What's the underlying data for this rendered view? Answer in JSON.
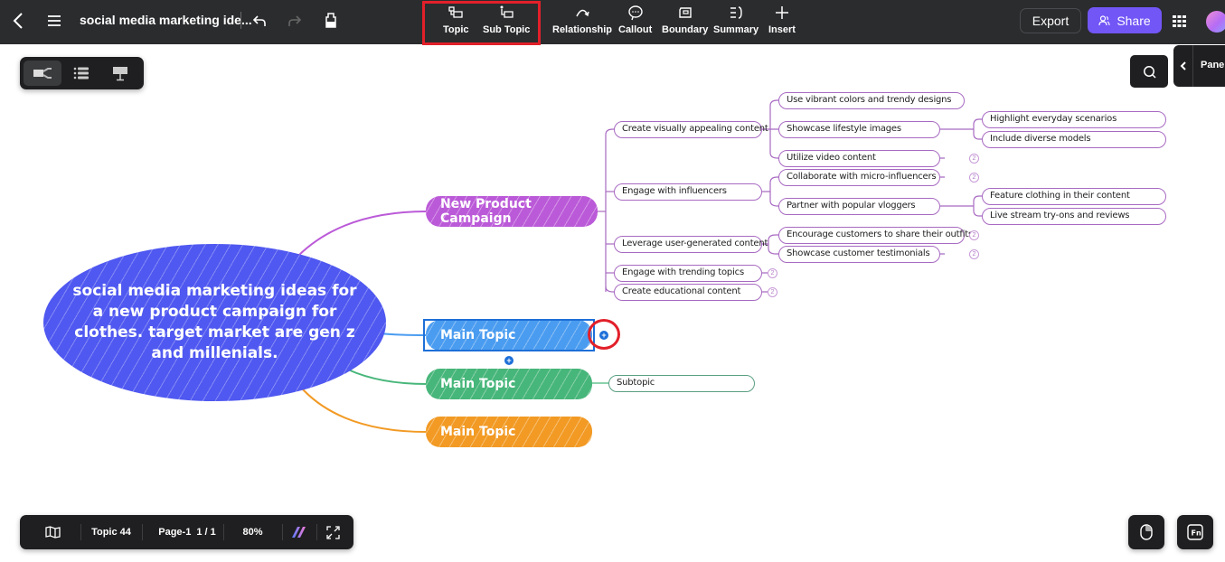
{
  "header": {
    "title": "social media marketing ide...",
    "tools": [
      {
        "label": "Topic",
        "icon": "topic-icon"
      },
      {
        "label": "Sub Topic",
        "icon": "subtopic-icon"
      },
      {
        "label": "Relationship",
        "icon": "relationship-icon"
      },
      {
        "label": "Callout",
        "icon": "callout-icon"
      },
      {
        "label": "Boundary",
        "icon": "boundary-icon"
      },
      {
        "label": "Summary",
        "icon": "summary-icon"
      },
      {
        "label": "Insert",
        "icon": "plus-icon"
      }
    ],
    "export_label": "Export",
    "share_label": "Share"
  },
  "side": {
    "panel_label": "Panel"
  },
  "mindmap": {
    "central": "social media marketing ideas for a new product campaign for clothes. target market are gen z and millenials.",
    "main_topics": [
      {
        "label": "New Product Campaign",
        "color": "#bb5ad8"
      },
      {
        "label": "Main Topic",
        "color": "#4a9cf0"
      },
      {
        "label": "Main Topic",
        "color": "#47b67a"
      },
      {
        "label": "Main Topic",
        "color": "#f29a24"
      }
    ],
    "level1": [
      "Create visually appealing content",
      "Engage with influencers",
      "Leverage user-generated content",
      "Engage with trending topics",
      "Create educational content"
    ],
    "level2": [
      "Use vibrant colors and trendy designs",
      "Showcase lifestyle images",
      "Utilize video content",
      "Collaborate with micro-influencers",
      "Partner with popular vloggers",
      "Encourage customers to share their outfits",
      "Showcase customer testimonials"
    ],
    "level3": [
      "Highlight everyday scenarios",
      "Include diverse models",
      "Feature clothing in their content",
      "Live stream try-ons and reviews"
    ],
    "collapsed_badge": "2",
    "green_subtopic": "Subtopic"
  },
  "footer": {
    "topic_count": "Topic 44",
    "page": "Page-1",
    "page_of": "1 / 1",
    "zoom": "80%"
  },
  "colors": {
    "accent": "#7256f6",
    "highlight": "#e2202a",
    "selection": "#1d6fd8"
  }
}
